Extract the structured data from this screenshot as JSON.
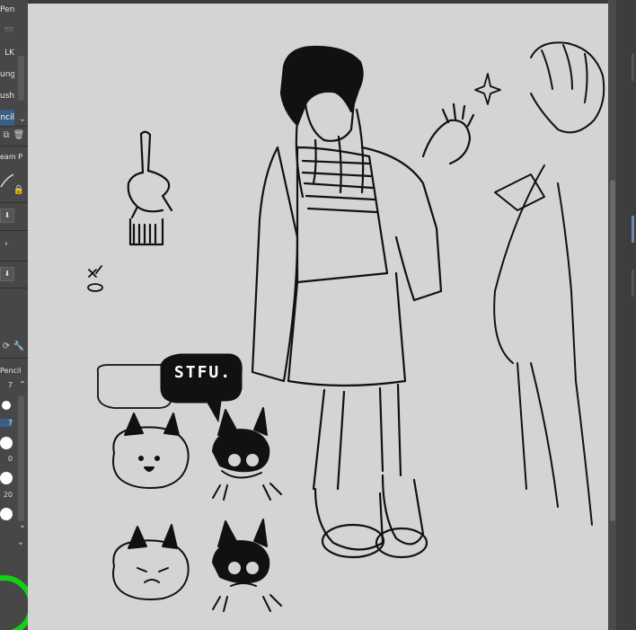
{
  "toolbar_left": {
    "tools": [
      {
        "label": "Pen"
      },
      {
        "label": ""
      },
      {
        "label": "LK"
      },
      {
        "label": "ung"
      },
      {
        "label": "ush"
      },
      {
        "label": "ncil"
      }
    ],
    "subtool_label": "eam P",
    "brush_panel_title": "Pencil",
    "brush_sizes": [
      "7",
      "7",
      "0",
      "20"
    ],
    "icons": [
      "lasso-icon",
      "chevron-down-icon",
      "copy-icon",
      "trash-icon",
      "lock-icon",
      "download-icon",
      "chevron-right-icon",
      "download-icon",
      "refresh-icon",
      "wrench-icon",
      "chevron-up-icon",
      "chevron-down-icon"
    ]
  },
  "canvas": {
    "speech_bubble_text": "STFU."
  }
}
